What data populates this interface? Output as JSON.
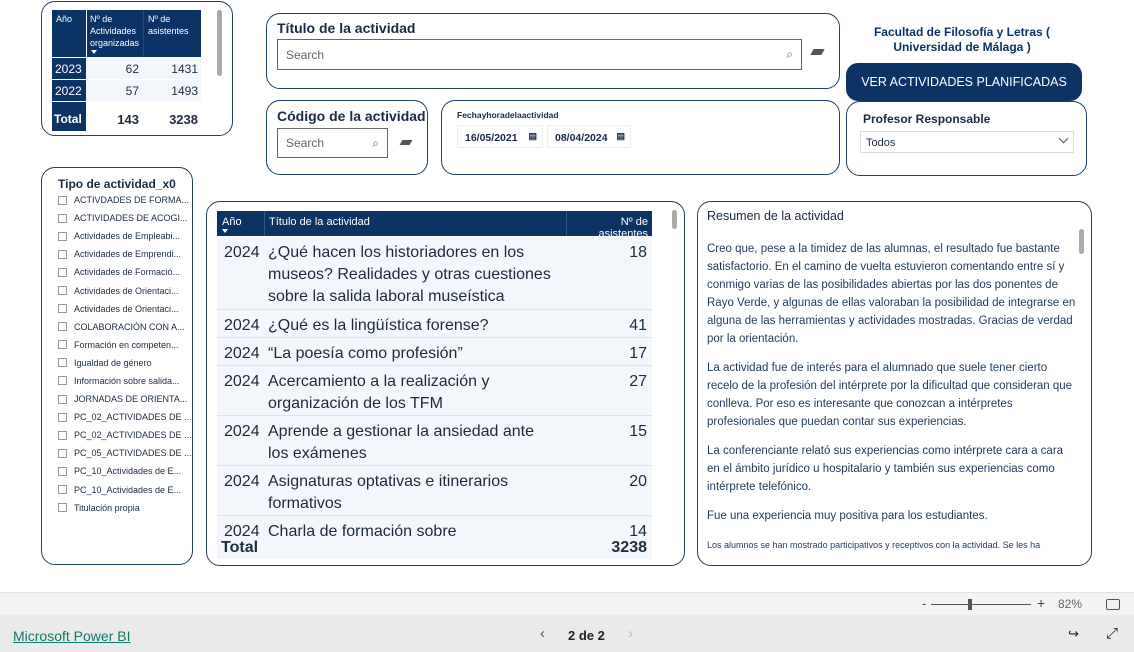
{
  "year_table": {
    "headers": [
      "Año",
      "Nº de Actividades organizadas",
      "Nº de asistentes"
    ],
    "rows": [
      {
        "year": "2023",
        "activities": "62",
        "attendees": "1431"
      },
      {
        "year": "2022",
        "activities": "57",
        "attendees": "1493"
      }
    ],
    "total": {
      "label": "Total",
      "activities": "143",
      "attendees": "3238"
    }
  },
  "title_filter": {
    "label": "Título de la actividad",
    "placeholder": "Search"
  },
  "code_filter": {
    "label": "Código de la actividad",
    "placeholder": "Search"
  },
  "date_filter": {
    "label": "Fechayhoradelaactividad",
    "start": "16/05/2021",
    "end": "08/04/2024"
  },
  "faculty": {
    "line1": "Facultad de Filosofía y Letras (",
    "line2": "Universidad de Málaga )"
  },
  "planned_button": "VER ACTIVIDADES PLANIFICADAS",
  "professor_filter": {
    "label": "Profesor Responsable",
    "value": "Todos"
  },
  "type_filter": {
    "label": "Tipo de actividad_x0",
    "items": [
      "ACTIVDADES DE FORMA...",
      "ACTIVIDADES DE ACOGI...",
      "Actividades de Empleabi...",
      "Actividades de Emprendi...",
      "Actividades de Formació...",
      "Actividades de Orientaci...",
      "Actividades de Orientaci...",
      "COLABORACIÓN CON A...",
      "Formación en competen...",
      "Igualdad de género",
      "Información sobre salida...",
      "JORNADAS DE ORIENTA...",
      "PC_02_ACTIVIDADES DE ...",
      "PC_02_ACTIVIDADES DE ...",
      "PC_05_ACTIVIDADES DE ...",
      "PC_10_Actividades de E...",
      "PC_10_Actividades de E...",
      "Titulación propia"
    ]
  },
  "main_table": {
    "headers": [
      "Año",
      "Título de la actividad",
      "Nº de asistentes"
    ],
    "rows": [
      {
        "year": "2024",
        "title": "¿Qué hacen los historiadores en los museos? Realidades y otras cuestiones sobre la salida laboral museística",
        "attendees": "18"
      },
      {
        "year": "2024",
        "title": "¿Qué es la lingüística forense?",
        "attendees": "41"
      },
      {
        "year": "2024",
        "title": "“La poesía como profesión”",
        "attendees": "17"
      },
      {
        "year": "2024",
        "title": "Acercamiento a la realización y organización de los TFM",
        "attendees": "27"
      },
      {
        "year": "2024",
        "title": "Aprende a gestionar la ansiedad ante los exámenes",
        "attendees": "15"
      },
      {
        "year": "2024",
        "title": "Asignaturas optativas e itinerarios formativos",
        "attendees": "20"
      },
      {
        "year": "2024",
        "title": "Charla de formación sobre",
        "attendees": "14"
      }
    ],
    "total": {
      "label": "Total",
      "attendees": "3238"
    }
  },
  "summary": {
    "title": "Resumen de la actividad",
    "paragraphs": [
      "Creo que, pese a la timidez de las alumnas, el resultado fue bastante satisfactorio. En el camino de vuelta estuvieron comentando entre sí y conmigo varias de las posibilidades abiertas por las dos ponentes de Rayo Verde, y algunas de ellas valoraban la posibilidad de integrarse en alguna de las herramientas y actividades mostradas. Gracias de verdad por la orientación.",
      "La actividad fue de interés para el alumnado que suele tener cierto recelo de la profesión del intérprete por la dificultad que consideran que conlleva. Por eso es interesante que conozcan a intérpretes profesionales que puedan contar sus experiencias.",
      "La conferenciante relató sus experiencias como intérprete cara a cara en el ámbito jurídico u hospitalario y también sus experiencias como intérprete telefónico.",
      "Fue una experiencia muy positiva para los estudiantes."
    ],
    "small_paragraph": "Los alumnos se han mostrado participativos y receptivos con la actividad. Se les ha"
  },
  "zoom": {
    "minus": "-",
    "plus": "+",
    "value": "82%",
    "level_percent": 82
  },
  "footer": {
    "brand": "Microsoft Power BI",
    "page": "2 de 2"
  },
  "colors": {
    "navy": "#0b3364",
    "row_bg": "#f3f7fc"
  }
}
